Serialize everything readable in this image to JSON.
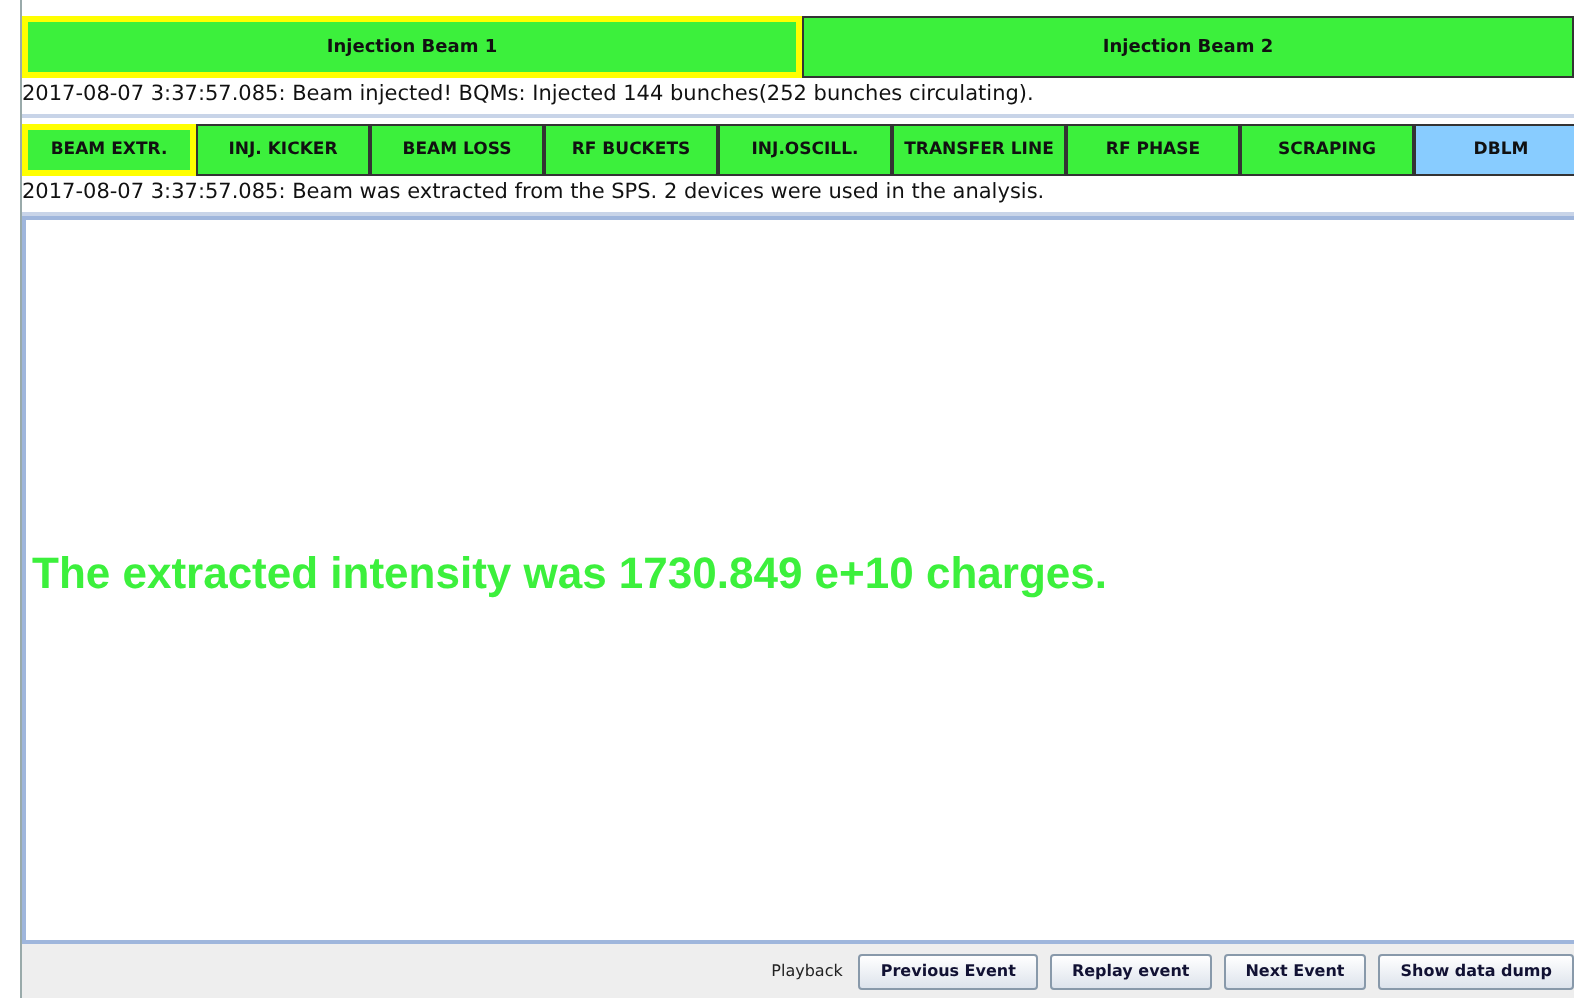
{
  "beam_tabs": [
    {
      "label": "Injection Beam 1",
      "selected": true
    },
    {
      "label": "Injection Beam 2",
      "selected": false
    }
  ],
  "injection_message": "2017-08-07 3:37:57.085: Beam injected! BQMs: Injected 144 bunches(252 bunches circulating).",
  "analysis_tabs": [
    {
      "label": "BEAM EXTR.",
      "selected": true,
      "color": "#3cf03c"
    },
    {
      "label": "INJ. KICKER",
      "selected": false,
      "color": "#3cf03c"
    },
    {
      "label": "BEAM LOSS",
      "selected": false,
      "color": "#3cf03c"
    },
    {
      "label": "RF BUCKETS",
      "selected": false,
      "color": "#3cf03c"
    },
    {
      "label": "INJ.OSCILL.",
      "selected": false,
      "color": "#3cf03c"
    },
    {
      "label": "TRANSFER LINE",
      "selected": false,
      "color": "#3cf03c"
    },
    {
      "label": "RF PHASE",
      "selected": false,
      "color": "#3cf03c"
    },
    {
      "label": "SCRAPING",
      "selected": false,
      "color": "#3cf03c"
    },
    {
      "label": "DBLM",
      "selected": false,
      "color": "#88ccff"
    }
  ],
  "analysis_message": "2017-08-07 3:37:57.085: Beam was extracted from the SPS. 2 devices were used in the analysis.",
  "result_text": "The extracted intensity was 1730.849 e+10 charges.",
  "playback": {
    "label": "Playback",
    "buttons": [
      "Previous Event",
      "Replay event",
      "Next Event",
      "Show data dump"
    ]
  }
}
